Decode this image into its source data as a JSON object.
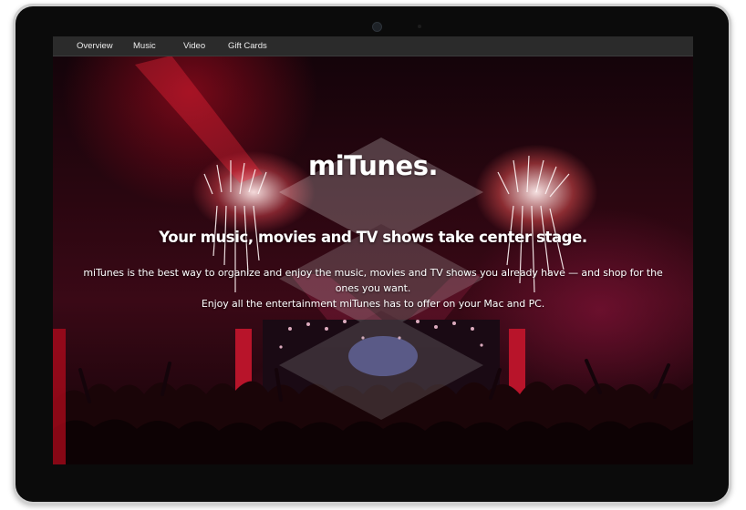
{
  "nav": {
    "items": [
      {
        "label": "Overview"
      },
      {
        "label": "Music"
      },
      {
        "label": "Video"
      },
      {
        "label": "Gift Cards"
      }
    ]
  },
  "hero": {
    "title": "miTunes.",
    "subtitle": "Your music, movies and TV shows take center stage.",
    "description_line1": "miTunes is the best way to organize and enjoy the music, movies and TV shows you already have — and shop for the ones you want.",
    "description_line2": "Enjoy all the entertainment miTunes has to offer on your Mac and PC."
  },
  "colors": {
    "device_frame": "#cfcfcf",
    "bezel": "#0b0b0b",
    "navbar": "#2b2b2b",
    "accent_stage": "#e0203a"
  },
  "icons": {
    "watermark": "layers-stack-logo"
  }
}
